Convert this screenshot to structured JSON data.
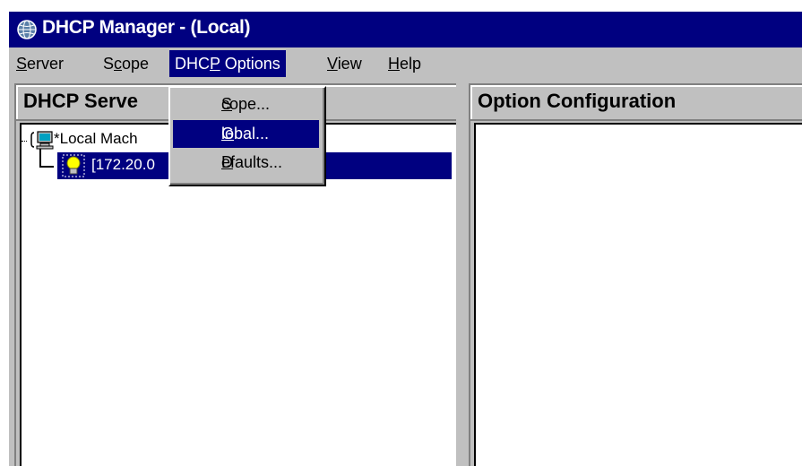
{
  "window": {
    "title": "DHCP Manager - (Local)",
    "icon": "globe-network-icon"
  },
  "menubar": {
    "items": [
      {
        "pre": "",
        "key": "S",
        "post": "erver"
      },
      {
        "pre": "S",
        "key": "c",
        "post": "ope"
      },
      {
        "pre": "DHC",
        "key": "P",
        "post": " Options"
      },
      {
        "pre": "",
        "key": "V",
        "post": "iew"
      },
      {
        "pre": "",
        "key": "H",
        "post": "elp"
      }
    ]
  },
  "dropdown": {
    "items": [
      {
        "key": "S",
        "post": "cope..."
      },
      {
        "key": "G",
        "post": "lobal..."
      },
      {
        "key": "D",
        "post": "efaults..."
      }
    ],
    "highlighted_index": 1
  },
  "left_pane": {
    "header": "DHCP Serve",
    "tree": {
      "root_label": "*Local Mach",
      "root_icon": "computer-icon",
      "child_label": "[172.20.0",
      "child_icon": "lightbulb-icon"
    }
  },
  "right_pane": {
    "header": "Option Configuration"
  },
  "colors": {
    "title_bar": "#000080",
    "face": "#c0c0c0",
    "highlight": "#000080"
  }
}
